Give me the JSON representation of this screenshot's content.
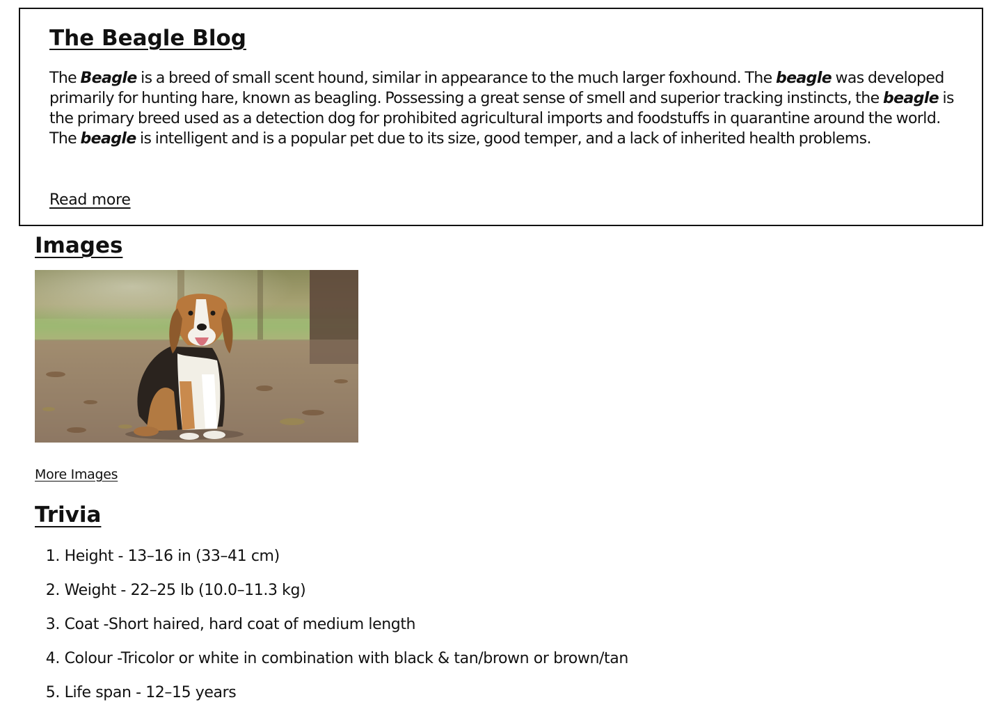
{
  "blog": {
    "title": "The Beagle Blog",
    "intro": [
      "The ",
      {
        "em": "Beagle"
      },
      " is a breed of small scent hound, similar in appearance to the much larger foxhound. The ",
      {
        "em": "beagle"
      },
      " was developed primarily for hunting hare, known as beagling. Possessing a great sense of smell and superior tracking instincts, the ",
      {
        "em": "beagle"
      },
      " is the primary breed used as a detection dog for prohibited agricultural imports and foodstuffs in quarantine around the world. The ",
      {
        "em": "beagle"
      },
      " is intelligent and is a popular pet due to its size, good temper, and a lack of inherited health problems."
    ],
    "read_more": "Read more"
  },
  "images": {
    "heading": "Images",
    "photo_alt": "Beagle dog sitting on a leaf-covered path",
    "more_link": "More Images"
  },
  "trivia": {
    "heading": "Trivia",
    "items": [
      {
        "num": "1.",
        "text": "Height - 13–16 in (33–41 cm)"
      },
      {
        "num": "2.",
        "text": "Weight - 22–25 lb (10.0–11.3 kg)"
      },
      {
        "num": "3.",
        "text": "Coat -Short haired, hard coat of medium length"
      },
      {
        "num": "4.",
        "text": "Colour -Tricolor or white in combination with black & tan/brown or brown/tan"
      },
      {
        "num": "5.",
        "text": "Life span - 12–15 years"
      }
    ]
  }
}
